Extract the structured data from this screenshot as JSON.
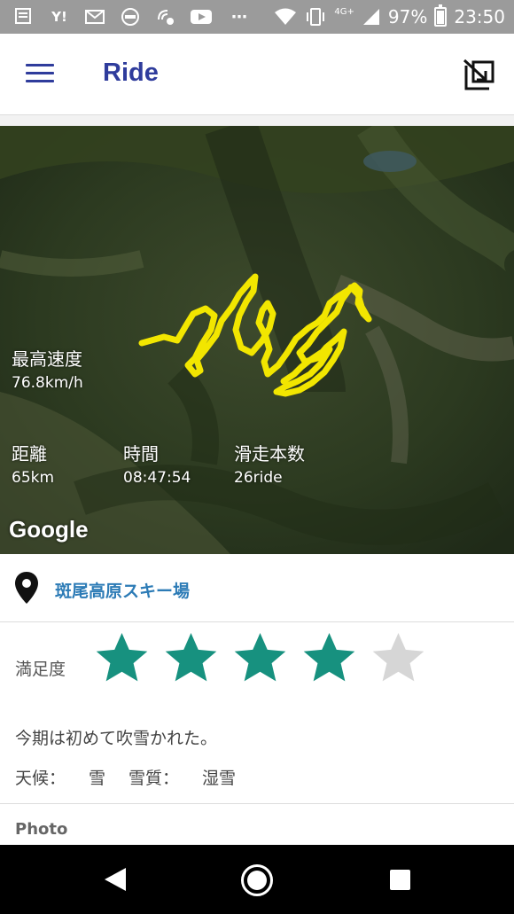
{
  "status_bar": {
    "icons_left": [
      "dmenu-icon",
      "yahoo-icon",
      "mail-icon",
      "aeon-icon",
      "on-icon",
      "youtube-icon"
    ],
    "yahoo_text": "Y!",
    "battery": "97%",
    "time": "23:50",
    "network": "4G+"
  },
  "app_bar": {
    "title": "Ride"
  },
  "map": {
    "stats": {
      "max_speed_label": "最高速度",
      "max_speed_value": "76.8km/h",
      "distance_label": "距離",
      "distance_value": "65km",
      "time_label": "時間",
      "time_value": "08:47:54",
      "runs_label": "滑走本数",
      "runs_value": "26ride"
    },
    "attribution": "Google",
    "track_color": "#f2e600"
  },
  "location": {
    "name": "斑尾高原スキー場"
  },
  "rating": {
    "label": "満足度",
    "value": 4,
    "max": 5,
    "filled_color": "#17917f",
    "empty_color": "#d6d6d6"
  },
  "comment": "今期は初めて吹雪かれた。",
  "conditions": {
    "weather_label": "天候：",
    "weather_value": "雪",
    "snow_label": "雪質：",
    "snow_value": "湿雪"
  },
  "photo_label": "Photo"
}
